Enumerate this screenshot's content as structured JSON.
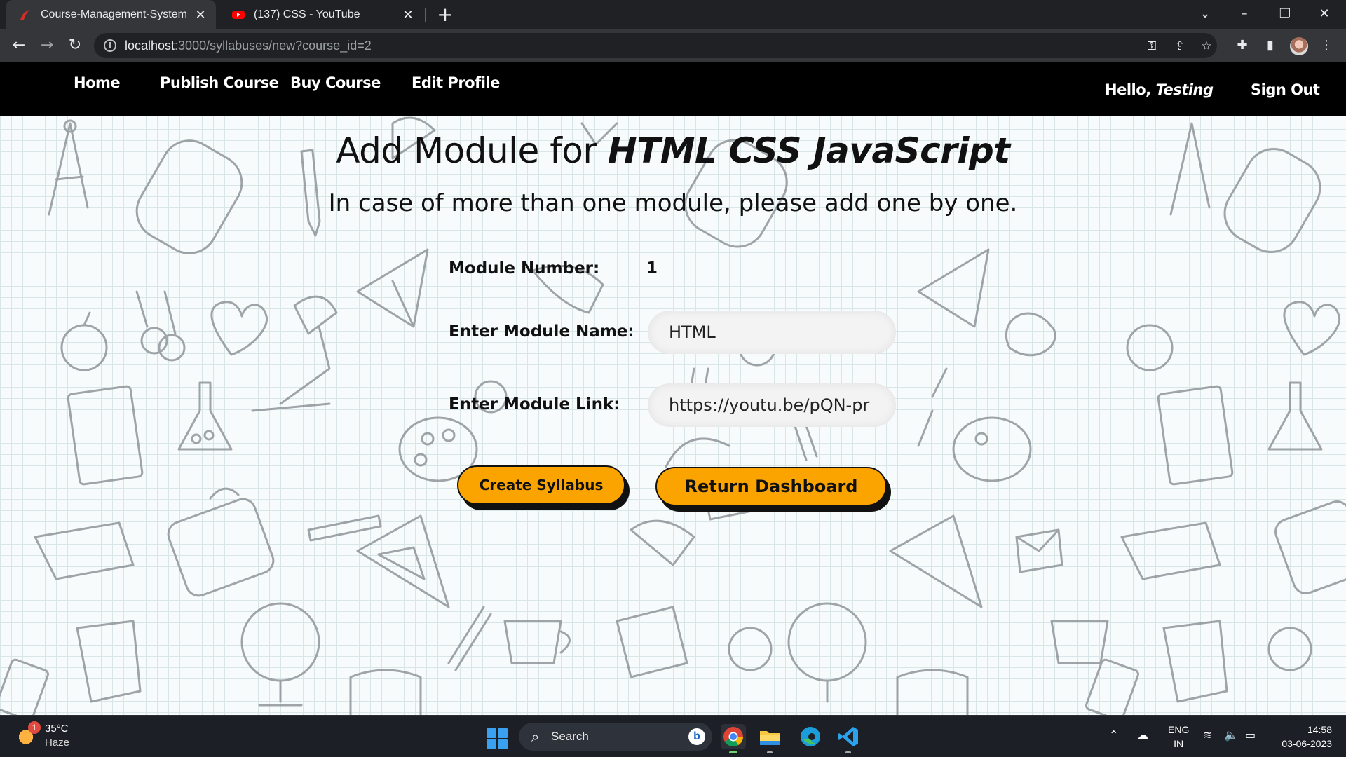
{
  "browser": {
    "tabs": [
      {
        "title": "Course-Management-System",
        "active": true
      },
      {
        "title": "(137) CSS - YouTube",
        "active": false
      }
    ],
    "url_host": "localhost",
    "url_rest": ":3000/syllabuses/new?course_id=2"
  },
  "nav": {
    "links": [
      "Home",
      "Publish Course",
      "Buy Course",
      "Edit Profile"
    ],
    "greeting": "Hello,",
    "user": "Testing",
    "signout": "Sign Out"
  },
  "page": {
    "title_prefix": "Add Module for ",
    "course_name": "HTML CSS JavaScript",
    "subtitle": "In case of more than one module, please add one by one.",
    "module_number_label": "Module Number:",
    "module_number_value": "1",
    "module_name_label": "Enter Module Name:",
    "module_name_value": "HTML",
    "module_link_label": "Enter Module Link:",
    "module_link_value": "https://youtu.be/pQN-pr",
    "create_button": "Create Syllabus",
    "return_button": "Return Dashboard"
  },
  "colors": {
    "button_orange": "#fba400",
    "navbar_bg": "#000000"
  },
  "taskbar": {
    "temperature": "35°C",
    "condition": "Haze",
    "notification_count": "1",
    "search": "Search",
    "lang_top": "ENG",
    "lang_bottom": "IN",
    "time": "14:58",
    "date": "03-06-2023"
  }
}
